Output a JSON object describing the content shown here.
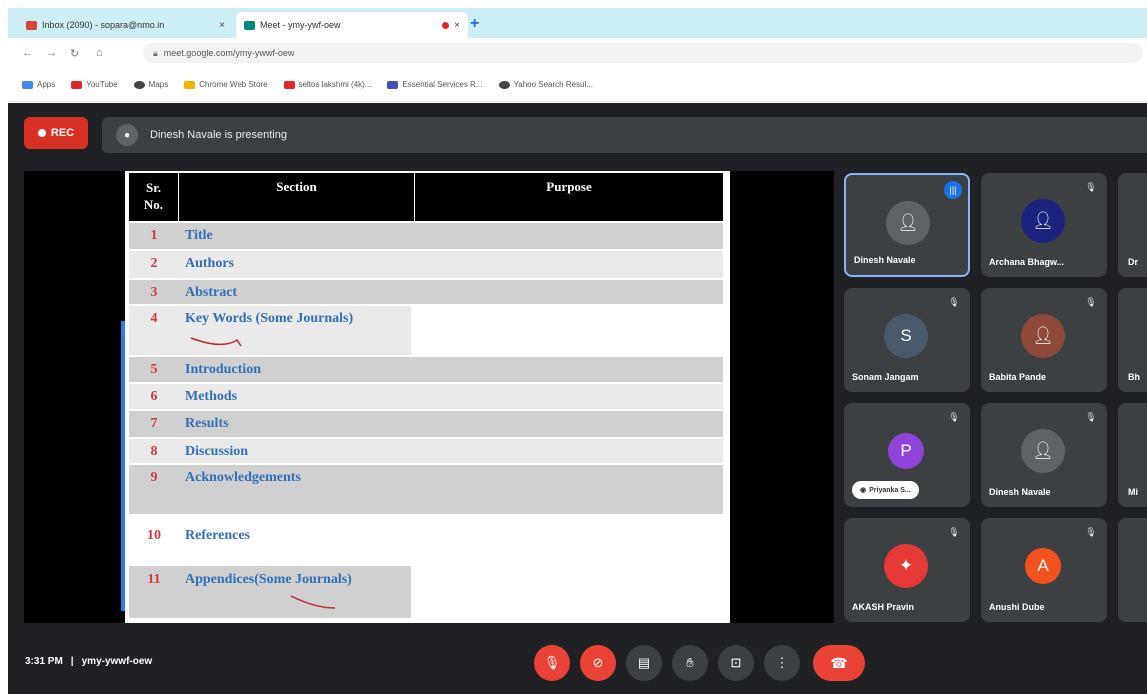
{
  "browser": {
    "tabs": [
      {
        "title": "Inbox (2090) - sopara@nmo.in",
        "fav_color": "#d44638"
      },
      {
        "title": "Meet - ymy-ywf-oew",
        "fav_color": "#00897b"
      }
    ],
    "new_tab": "+",
    "close": "×",
    "url": "meet.google.com/ymy-ywwf-oew",
    "bookmarks": [
      {
        "label": "Apps",
        "color": "#4285f4"
      },
      {
        "label": "YouTube",
        "color": "#e0262b"
      },
      {
        "label": "Maps",
        "color": "#444444"
      },
      {
        "label": "Chrome Web Store",
        "color": "#f4b400"
      },
      {
        "label": "seltos lakshmi (4k)...",
        "color": "#e0262b"
      },
      {
        "label": "Essential Services R...",
        "color": "#3f51b5"
      },
      {
        "label": "Yahoo Search Resul...",
        "color": "#444444"
      }
    ]
  },
  "meet": {
    "rec_label": "REC",
    "presenting_text": "Dinesh Navale is presenting",
    "slide": {
      "headers": [
        "Sr.\nNo.",
        "Section",
        "Purpose"
      ],
      "rows": [
        {
          "no": "1",
          "section": "Title"
        },
        {
          "no": "2",
          "section": "Authors"
        },
        {
          "no": "3",
          "section": "Abstract"
        },
        {
          "no": "4",
          "section": "Key Words (Some Journals)"
        },
        {
          "no": "5",
          "section": "Introduction"
        },
        {
          "no": "6",
          "section": "Methods"
        },
        {
          "no": "7",
          "section": "Results"
        },
        {
          "no": "8",
          "section": "Discussion"
        },
        {
          "no": "9",
          "section": "Acknowledgements"
        },
        {
          "no": "10",
          "section": "References"
        },
        {
          "no": "11",
          "section": "Appendices(Some Journals)"
        }
      ]
    },
    "participants": [
      {
        "name": "Dinesh Navale",
        "initial": "",
        "color": "#5f6368"
      },
      {
        "name": "Archana Bhagw...",
        "initial": "",
        "color": "#1a237e"
      },
      {
        "name": "Sonam Jangam",
        "initial": "S",
        "color": "#4a5a6a"
      },
      {
        "name": "Babita Pande",
        "initial": "",
        "color": "#8d4a3a"
      },
      {
        "name": "Priyanka S...",
        "initial": "P",
        "color": "#8e44d8"
      },
      {
        "name": "Dinesh Navale",
        "initial": "",
        "color": "#5f6368"
      },
      {
        "name": "AKASH Pravin",
        "initial": "",
        "color": "#e53935"
      },
      {
        "name": "Anushi Dube",
        "initial": "A",
        "color": "#f4511e"
      }
    ],
    "partial_names": [
      "Dr",
      "Bh",
      "Mi",
      ""
    ],
    "time": "3:31 PM",
    "separator": "|",
    "meeting_code": "ymy-ywwf-oew"
  }
}
